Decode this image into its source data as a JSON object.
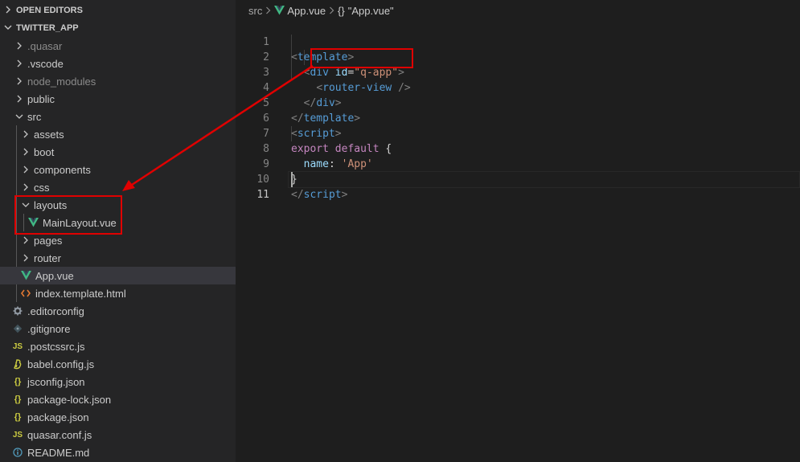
{
  "sidebar": {
    "open_editors": "OPEN EDITORS",
    "project": "TWITTER_APP",
    "items": [
      {
        "label": ".quasar",
        "icon": "chevron-right-icon",
        "dim": true
      },
      {
        "label": ".vscode",
        "icon": "chevron-right-icon"
      },
      {
        "label": "node_modules",
        "icon": "chevron-right-icon",
        "dim": true
      },
      {
        "label": "public",
        "icon": "chevron-right-icon"
      },
      {
        "label": "src",
        "icon": "chevron-down-icon"
      },
      {
        "label": "assets",
        "icon": "chevron-right-icon"
      },
      {
        "label": "boot",
        "icon": "chevron-right-icon"
      },
      {
        "label": "components",
        "icon": "chevron-right-icon"
      },
      {
        "label": "css",
        "icon": "chevron-right-icon"
      },
      {
        "label": "layouts",
        "icon": "chevron-down-icon"
      },
      {
        "label": "MainLayout.vue",
        "icon": "vue-icon"
      },
      {
        "label": "pages",
        "icon": "chevron-right-icon"
      },
      {
        "label": "router",
        "icon": "chevron-right-icon"
      },
      {
        "label": "App.vue",
        "icon": "vue-icon"
      },
      {
        "label": "index.template.html",
        "icon": "html-icon"
      },
      {
        "label": ".editorconfig",
        "icon": "gear-icon"
      },
      {
        "label": ".gitignore",
        "icon": "git-icon"
      },
      {
        "label": ".postcssrc.js",
        "icon": "js-icon"
      },
      {
        "label": "babel.config.js",
        "icon": "babel-icon"
      },
      {
        "label": "jsconfig.json",
        "icon": "json-icon"
      },
      {
        "label": "package-lock.json",
        "icon": "json-icon"
      },
      {
        "label": "package.json",
        "icon": "json-icon"
      },
      {
        "label": "quasar.conf.js",
        "icon": "js-icon"
      },
      {
        "label": "README.md",
        "icon": "info-icon"
      }
    ],
    "icon_glyphs": {
      "js": "JS",
      "json": "{}"
    }
  },
  "breadcrumb": {
    "folder": "src",
    "file": "App.vue",
    "symbol": "\"App.vue\"",
    "symbol_glyph": "{}"
  },
  "editor": {
    "line_numbers": [
      "1",
      "2",
      "3",
      "4",
      "5",
      "6",
      "7",
      "8",
      "9",
      "10",
      "11"
    ],
    "active_line": "11",
    "lines": {
      "l1": {
        "a": "<",
        "b": "template",
        "c": ">"
      },
      "l2": {
        "a": "<",
        "b": "div",
        "c": "id",
        "d": "=",
        "e": "\"q-app\"",
        "f": ">"
      },
      "l3": {
        "a": "<",
        "b": "router-view",
        "c": "/>"
      },
      "l4": {
        "a": "</",
        "b": "div",
        "c": ">"
      },
      "l5": {
        "a": "</",
        "b": "template",
        "c": ">"
      },
      "l6": {
        "a": "<",
        "b": "script",
        "c": ">"
      },
      "l7": {
        "a": "export",
        "b": "default",
        "c": "{"
      },
      "l8": {
        "a": "name",
        "b": ":",
        "c": "'App'"
      },
      "l9": {
        "a": "}"
      },
      "l10": {
        "a": "</",
        "b": "script",
        "c": ">"
      }
    }
  },
  "colors": {
    "annotation": "#e00000",
    "vue_green": "#41b883",
    "js_yellow": "#cbcb41",
    "html_orange": "#e37933",
    "info_blue": "#519aba"
  }
}
